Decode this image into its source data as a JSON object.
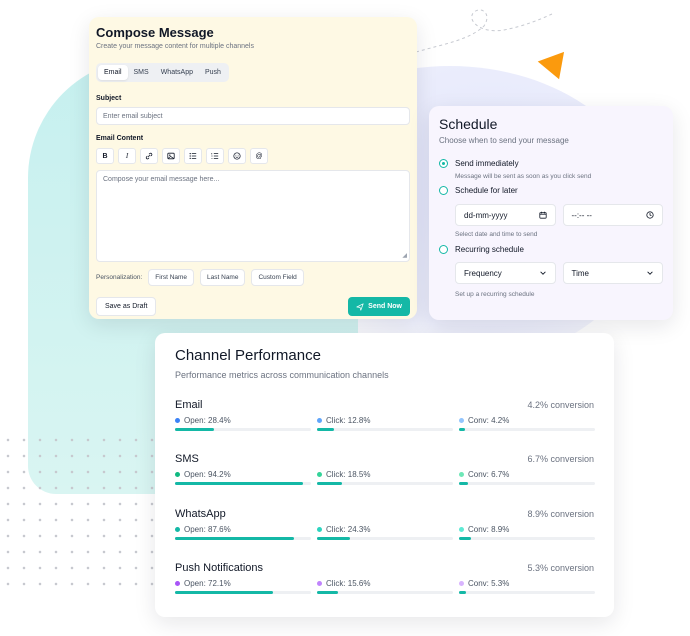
{
  "compose": {
    "title": "Compose Message",
    "subtitle": "Create your message content for multiple channels",
    "tabs": [
      "Email",
      "SMS",
      "WhatsApp",
      "Push"
    ],
    "active_tab": "Email",
    "subject_label": "Subject",
    "subject_placeholder": "Enter email subject",
    "content_label": "Email Content",
    "toolbar": [
      {
        "icon": "bold-icon",
        "glyph": "B"
      },
      {
        "icon": "italic-icon",
        "glyph": "I"
      },
      {
        "icon": "link-icon",
        "glyph": "🔗"
      },
      {
        "icon": "image-icon",
        "glyph": "▣"
      },
      {
        "icon": "bullet-list-icon",
        "glyph": "≔"
      },
      {
        "icon": "numbered-list-icon",
        "glyph": "☰"
      },
      {
        "icon": "emoji-icon",
        "glyph": "☺"
      },
      {
        "icon": "mention-icon",
        "glyph": "@"
      }
    ],
    "content_placeholder": "Compose your email message here...",
    "personalization_label": "Personalization:",
    "personalization_chips": [
      "First Name",
      "Last Name",
      "Custom Field"
    ],
    "draft_label": "Save as Draft",
    "send_label": "Send Now"
  },
  "schedule": {
    "title": "Schedule",
    "subtitle": "Choose when to send your message",
    "options": [
      {
        "label": "Send immediately",
        "checked": true,
        "hint": "Message will be sent as soon as you click send"
      },
      {
        "label": "Schedule for later",
        "checked": false,
        "hint": "Select date and time to send"
      },
      {
        "label": "Recurring schedule",
        "checked": false,
        "hint": "Set up a recurring schedule"
      }
    ],
    "date_value": "dd-mm-yyyy",
    "time_value": "--:-- --",
    "frequency_value": "Frequency",
    "recur_time_value": "Time"
  },
  "performance": {
    "title": "Channel Performance",
    "subtitle": "Performance metrics across communication channels",
    "channels": [
      {
        "name": "Email",
        "conversion": "4.2% conversion",
        "metrics": [
          {
            "label": "Open: 28.4%",
            "value": 28.4,
            "color": "#3b82f6"
          },
          {
            "label": "Click: 12.8%",
            "value": 12.8,
            "color": "#60a5fa"
          },
          {
            "label": "Conv: 4.2%",
            "value": 4.2,
            "color": "#93c5fd"
          }
        ]
      },
      {
        "name": "SMS",
        "conversion": "6.7% conversion",
        "metrics": [
          {
            "label": "Open: 94.2%",
            "value": 94.2,
            "color": "#10b981"
          },
          {
            "label": "Click: 18.5%",
            "value": 18.5,
            "color": "#34d399"
          },
          {
            "label": "Conv: 6.7%",
            "value": 6.7,
            "color": "#6ee7b7"
          }
        ]
      },
      {
        "name": "WhatsApp",
        "conversion": "8.9% conversion",
        "metrics": [
          {
            "label": "Open: 87.6%",
            "value": 87.6,
            "color": "#14b8a6"
          },
          {
            "label": "Click: 24.3%",
            "value": 24.3,
            "color": "#2dd4bf"
          },
          {
            "label": "Conv: 8.9%",
            "value": 8.9,
            "color": "#5eead4"
          }
        ]
      },
      {
        "name": "Push Notifications",
        "conversion": "5.3% conversion",
        "metrics": [
          {
            "label": "Open: 72.1%",
            "value": 72.1,
            "color": "#a855f7"
          },
          {
            "label": "Click: 15.6%",
            "value": 15.6,
            "color": "#c084fc"
          },
          {
            "label": "Conv: 5.3%",
            "value": 5.3,
            "color": "#d8b4fe"
          }
        ]
      }
    ]
  },
  "colors": {
    "accent": "#14b8a6",
    "triangle": "#fb9a0d"
  }
}
